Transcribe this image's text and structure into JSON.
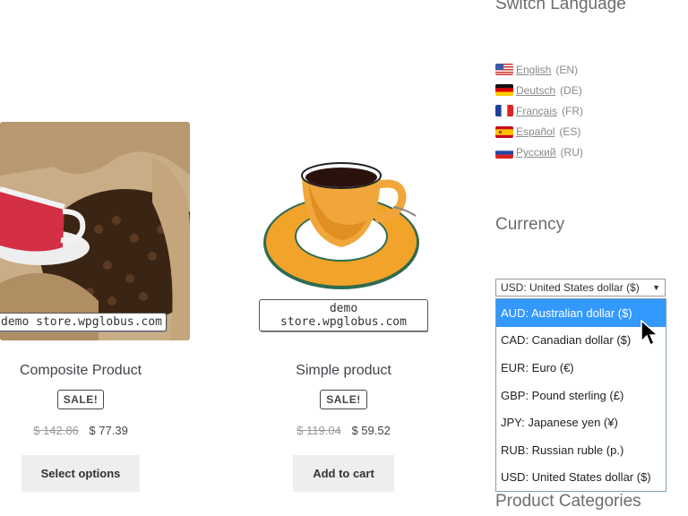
{
  "products": [
    {
      "title": "Composite Product",
      "sale_badge": "SALE!",
      "old_price": "$ 142.86",
      "new_price": "$ 77.39",
      "button": "Select options",
      "watermark": "demo store.wpglobus.com"
    },
    {
      "title": "Simple product",
      "sale_badge": "SALE!",
      "old_price": "$ 119.04",
      "new_price": "$ 59.52",
      "button": "Add to cart",
      "watermark": "demo store.wpglobus.com"
    }
  ],
  "sidebar": {
    "language_title": "Switch Language",
    "languages": [
      {
        "name": "English",
        "code": "(EN)",
        "flag": "us-flag-icon"
      },
      {
        "name": "Deutsch",
        "code": "(DE)",
        "flag": "de-flag-icon"
      },
      {
        "name": "Français",
        "code": "(FR)",
        "flag": "fr-flag-icon"
      },
      {
        "name": "Español",
        "code": "(ES)",
        "flag": "es-flag-icon"
      },
      {
        "name": "Русский",
        "code": "(RU)",
        "flag": "ru-flag-icon"
      }
    ],
    "currency_title": "Currency",
    "currency_selected": "USD: United States dollar ($)",
    "currency_options": [
      "AUD: Australian dollar ($)",
      "CAD: Canadian dollar ($)",
      "EUR: Euro (€)",
      "GBP: Pound sterling (£)",
      "JPY: Japanese yen (¥)",
      "RUB: Russian ruble (p.)",
      "USD: United States dollar ($)"
    ],
    "highlighted_option_index": 0,
    "categories_title": "Product Categories"
  },
  "colors": {
    "highlight": "#3399ff",
    "button_bg": "#eeeeee",
    "text": "#43454b",
    "widget_title": "#6d6d6d"
  }
}
